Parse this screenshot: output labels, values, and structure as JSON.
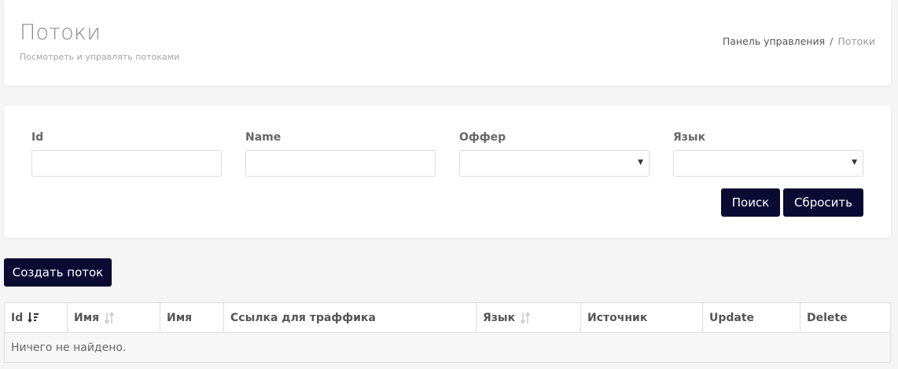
{
  "header": {
    "title": "Потоки",
    "subtitle": "Посмотреть и управлять потоками",
    "breadcrumb": {
      "home": "Панель управления",
      "separator": "/",
      "current": "Потоки"
    }
  },
  "filters": {
    "fields": [
      {
        "label": "Id",
        "type": "text",
        "value": ""
      },
      {
        "label": "Name",
        "type": "text",
        "value": ""
      },
      {
        "label": "Оффер",
        "type": "select",
        "value": ""
      },
      {
        "label": "Язык",
        "type": "select",
        "value": ""
      }
    ],
    "search_label": "Поиск",
    "reset_label": "Сбросить"
  },
  "create_button_label": "Создать поток",
  "table": {
    "columns": [
      {
        "label": "Id",
        "sort": "active-desc"
      },
      {
        "label": "Имя",
        "sort": "sortable"
      },
      {
        "label": "Имя",
        "sort": "none"
      },
      {
        "label": "Ссылка для траффика",
        "sort": "none"
      },
      {
        "label": "Язык",
        "sort": "sortable"
      },
      {
        "label": "Источник",
        "sort": "none"
      },
      {
        "label": "Update",
        "sort": "none"
      },
      {
        "label": "Delete",
        "sort": "none"
      }
    ],
    "empty_text": "Ничего не найдено."
  },
  "colors": {
    "primary_button": "#0b0a33",
    "page_background": "#f5f5f5"
  }
}
